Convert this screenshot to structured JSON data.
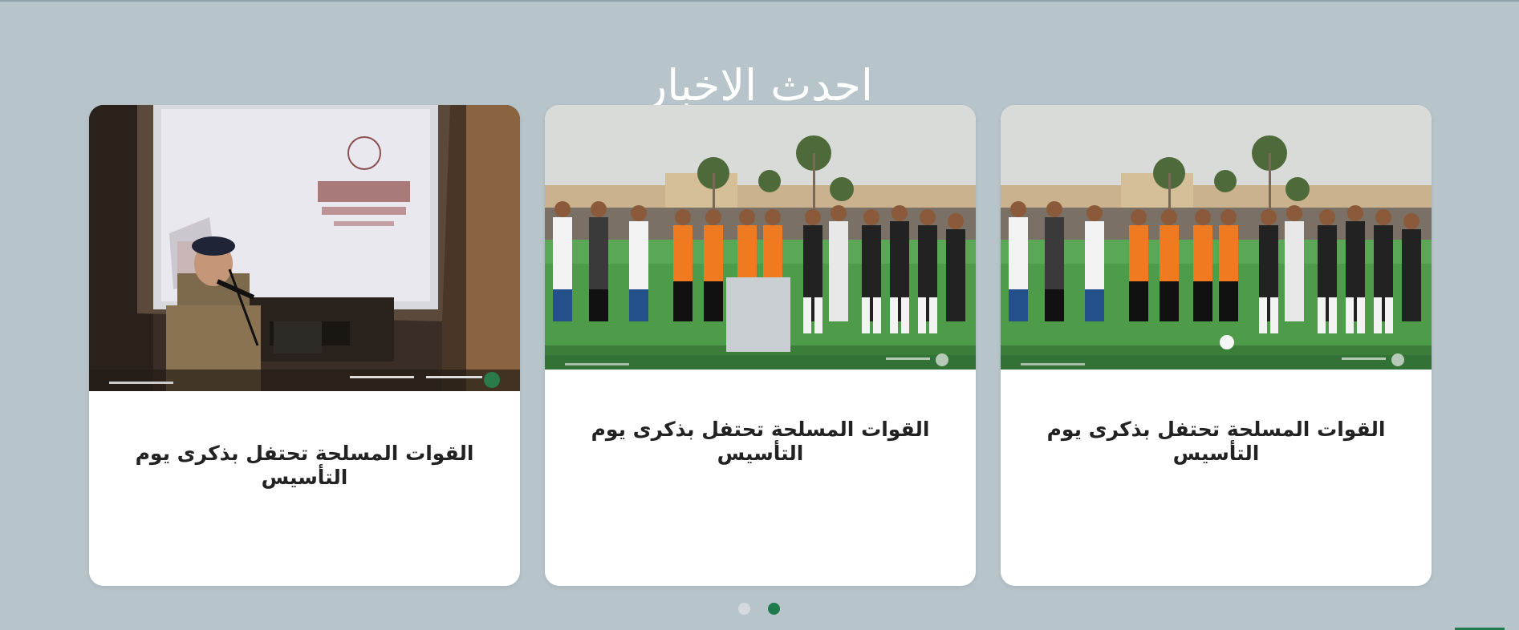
{
  "section": {
    "title": "احدث الاخبار"
  },
  "cards": [
    {
      "title": "القوات المسلحة تحتفل بذكرى يوم التأسيس",
      "image": "officer-speaking-at-podium-founding-day"
    },
    {
      "title": "القوات المسلحة تحتفل بذكرى يوم التأسيس",
      "image": "football-team-lineup"
    },
    {
      "title": "القوات المسلحة تحتفل بذكرى يوم التأسيس",
      "image": "football-team-lineup"
    }
  ],
  "carousel": {
    "total_pages": 2,
    "active_page": 2
  },
  "colors": {
    "background": "#b7c5cb",
    "accent": "#1f7a4c",
    "card": "#ffffff"
  }
}
